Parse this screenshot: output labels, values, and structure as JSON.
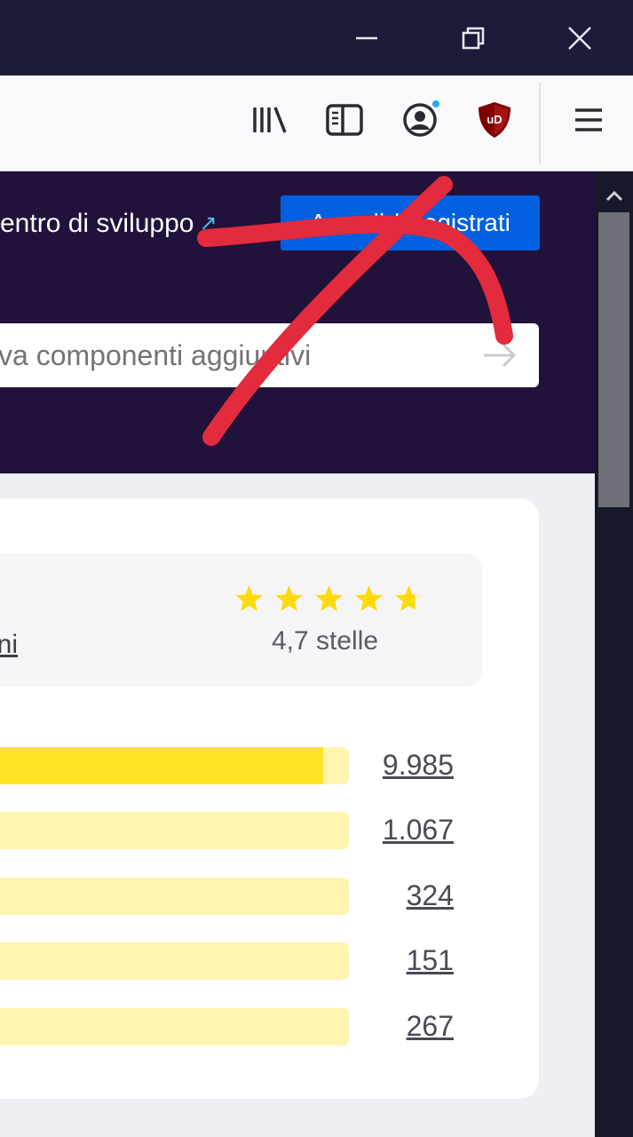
{
  "window_controls": {
    "minimize_icon": "minimize-icon",
    "restore_icon": "restore-icon",
    "close_icon": "close-icon"
  },
  "toolbar": {
    "icons": [
      "library-icon",
      "sidebar-icon",
      "account-icon",
      "ublock-origin-icon",
      "menu-icon"
    ],
    "ublock_label": "uD",
    "notification_color": "#2aa9ea"
  },
  "header": {
    "devhub_text": "entro di sviluppo",
    "login_label": "Accedi / Registrati",
    "brand_color": "#0060df"
  },
  "search": {
    "placeholder": "va componenti aggiuntivi"
  },
  "rating": {
    "reviews_link": "oni",
    "stars": 4.7,
    "stars_text": "4,7 stelle",
    "star_color": "#ffd90f"
  },
  "breakdown": [
    {
      "count": "9.985",
      "fill": 0.93
    },
    {
      "count": "1.067",
      "fill": 0.0
    },
    {
      "count": "324",
      "fill": 0.0
    },
    {
      "count": "151",
      "fill": 0.0
    },
    {
      "count": "267",
      "fill": 0.0
    }
  ],
  "annotation": {
    "color": "#e42a3d"
  }
}
